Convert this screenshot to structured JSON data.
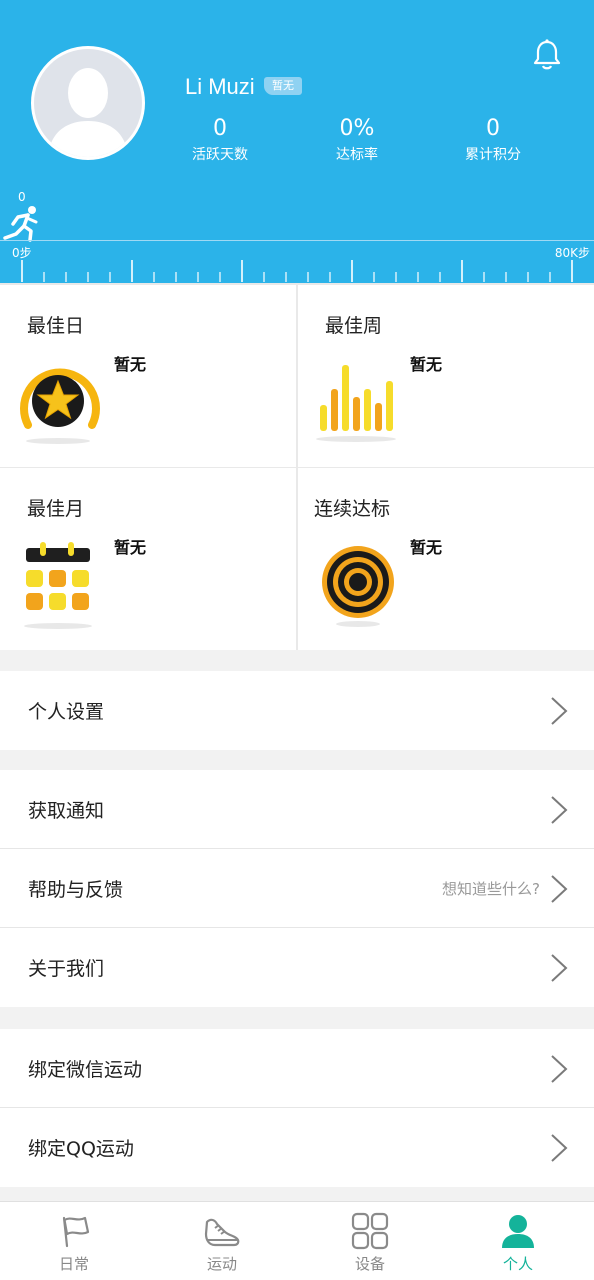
{
  "header": {
    "username": "Li Muzi",
    "badge": "暂无",
    "stats": [
      {
        "value": "0",
        "label": "活跃天数"
      },
      {
        "value": "0%",
        "label": "达标率"
      },
      {
        "value": "0",
        "label": "累计积分"
      }
    ],
    "runner_count": "0",
    "scale": {
      "start": "0步",
      "end": "80K步"
    },
    "bg_color": "#2bb3e9"
  },
  "achievements": [
    {
      "title": "最佳日",
      "value": "暂无",
      "icon": "star-medal-icon"
    },
    {
      "title": "最佳周",
      "value": "暂无",
      "icon": "bar-chart-icon"
    },
    {
      "title": "最佳月",
      "value": "暂无",
      "icon": "calendar-icon"
    },
    {
      "title": "连续达标",
      "value": "暂无",
      "icon": "target-icon"
    }
  ],
  "menu": {
    "group1": [
      {
        "label": "个人设置"
      }
    ],
    "group2": [
      {
        "label": "获取通知"
      },
      {
        "label": "帮助与反馈",
        "hint": "想知道些什么?"
      },
      {
        "label": "关于我们"
      }
    ],
    "group3": [
      {
        "label": "绑定微信运动"
      },
      {
        "label": "绑定QQ运动"
      }
    ]
  },
  "tabbar": {
    "tabs": [
      {
        "label": "日常",
        "icon": "flag-icon"
      },
      {
        "label": "运动",
        "icon": "shoe-icon"
      },
      {
        "label": "设备",
        "icon": "grid-icon"
      },
      {
        "label": "个人",
        "icon": "person-icon"
      }
    ],
    "active_index": 3,
    "active_color": "#14b39a"
  }
}
